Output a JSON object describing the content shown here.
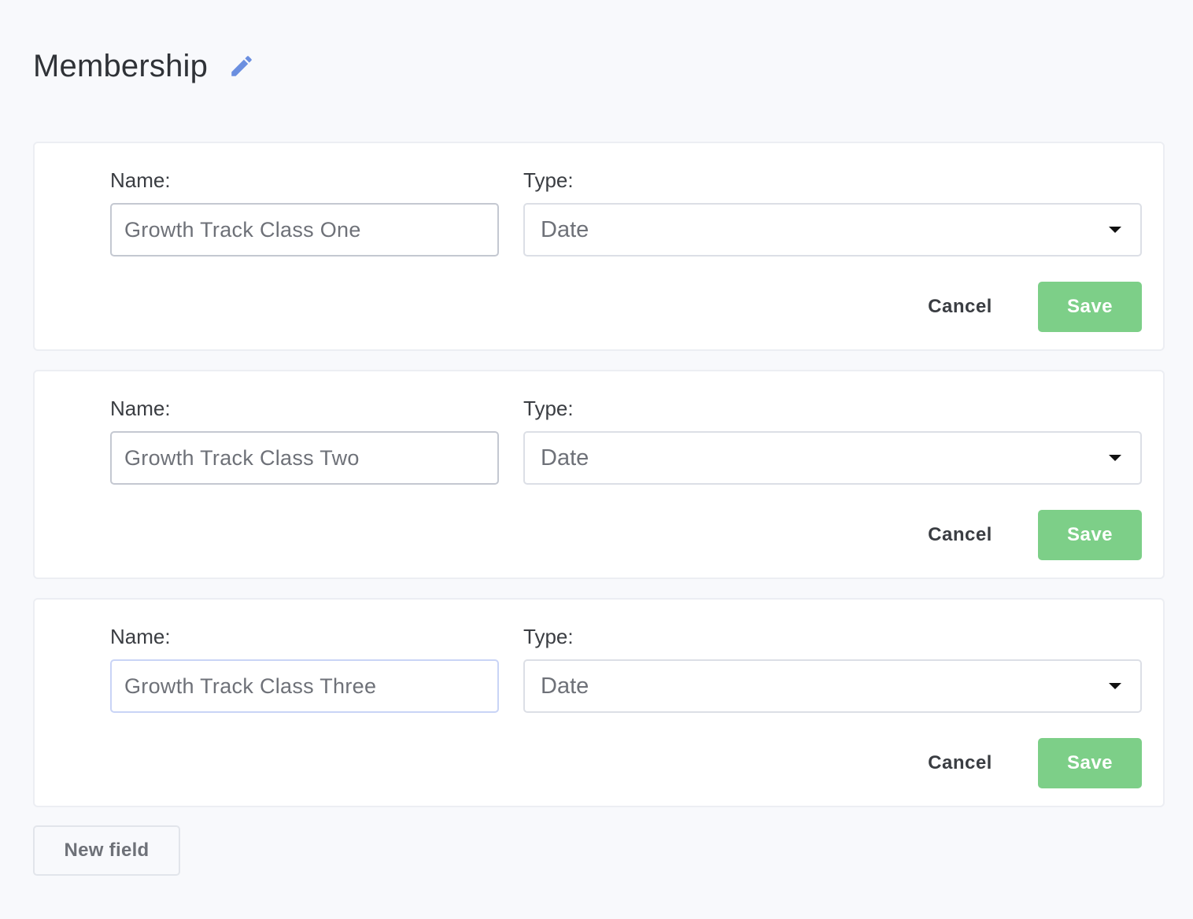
{
  "header": {
    "title": "Membership",
    "edit_icon": "pencil-icon",
    "accent_color": "#6b8fe0"
  },
  "fields": [
    {
      "name_label": "Name:",
      "name_value": "Growth Track Class One",
      "type_label": "Type:",
      "type_value": "Date",
      "cancel_label": "Cancel",
      "save_label": "Save"
    },
    {
      "name_label": "Name:",
      "name_value": "Growth Track Class Two",
      "type_label": "Type:",
      "type_value": "Date",
      "cancel_label": "Cancel",
      "save_label": "Save"
    },
    {
      "name_label": "Name:",
      "name_value": "Growth Track Class Three",
      "type_label": "Type:",
      "type_value": "Date",
      "cancel_label": "Cancel",
      "save_label": "Save"
    }
  ],
  "footer": {
    "new_field_label": "New field"
  },
  "colors": {
    "background": "#f8f9fc",
    "save_button": "#7dcf88",
    "text_primary": "#2f3237",
    "text_muted": "#6e7178"
  }
}
